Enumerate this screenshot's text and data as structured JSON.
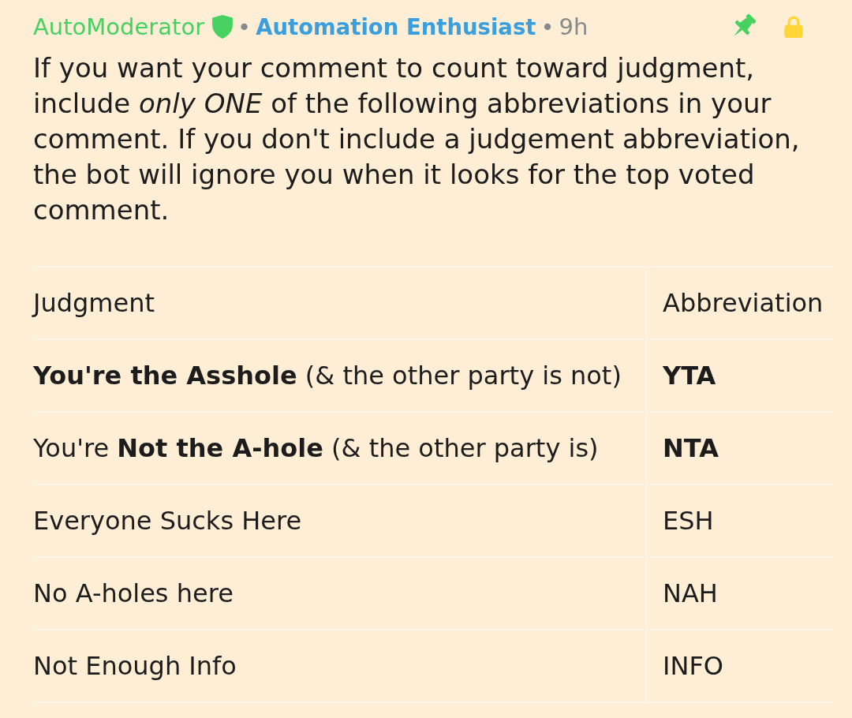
{
  "comment": {
    "author": "AutoModerator",
    "moderator": true,
    "separator_1": "•",
    "flair": "Automation Enthusiast",
    "separator_2": "•",
    "age": "9h",
    "pinned": true,
    "locked": true,
    "body": "If you want your comment to count toward judgment, include *only ONE* of the following abbreviations in your comment. If you don't include a judgement abbreviation, the bot will ignore you when it looks for the top voted comment."
  },
  "table": {
    "columns": [
      "Judgment",
      "Abbreviation"
    ],
    "rows": [
      {
        "judgment": "**You're the Asshole** (& the other party is not)",
        "abbreviation": "YTA",
        "abbreviation_bold": true
      },
      {
        "judgment": "You're **Not the A-hole** (& the other party is)",
        "abbreviation": "NTA",
        "abbreviation_bold": true
      },
      {
        "judgment": "Everyone Sucks Here",
        "abbreviation": "ESH",
        "abbreviation_bold": false
      },
      {
        "judgment": "No A-holes here",
        "abbreviation": "NAH",
        "abbreviation_bold": false
      },
      {
        "judgment": "Not Enough Info",
        "abbreviation": "INFO",
        "abbreviation_bold": false
      }
    ]
  }
}
